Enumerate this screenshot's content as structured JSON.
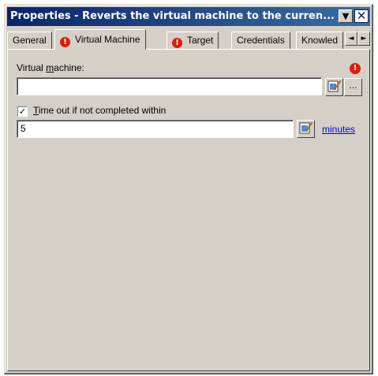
{
  "window": {
    "title": "Properties - Reverts the virtual machine to the curren...",
    "dropdown_glyph": "▼",
    "close_glyph": "✕"
  },
  "tabs": [
    {
      "label": "General",
      "warning": false,
      "active": false
    },
    {
      "label": "Virtual Machine",
      "warning": true,
      "active": true
    },
    {
      "label": "Target",
      "warning": true,
      "active": false
    },
    {
      "label": "Credentials",
      "warning": false,
      "active": false
    },
    {
      "label": "Knowled",
      "warning": false,
      "active": false
    }
  ],
  "tab_scroll": {
    "left": "◄",
    "right": "►"
  },
  "vm": {
    "label_pre": "Virtual ",
    "label_mnemonic": "m",
    "label_post": "achine:",
    "value": "",
    "browse_label": "...",
    "error_glyph": "!"
  },
  "timeout": {
    "checked": true,
    "check_glyph": "✓",
    "label_mnemonic": "T",
    "label_post": "ime out if not completed within",
    "value": "5",
    "unit_link": "minutes"
  },
  "colors": {
    "warning": "#d81e05",
    "title_start": "#0a246a",
    "link": "#0000ee"
  }
}
